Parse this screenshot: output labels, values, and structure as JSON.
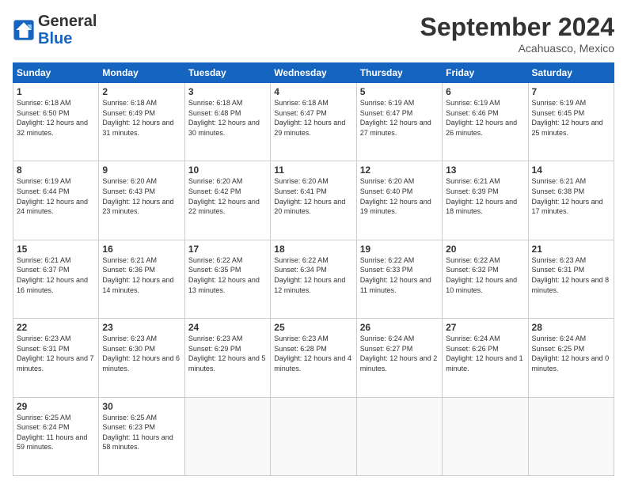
{
  "logo": {
    "text_general": "General",
    "text_blue": "Blue"
  },
  "header": {
    "month_title": "September 2024",
    "subtitle": "Acahuasco, Mexico"
  },
  "weekdays": [
    "Sunday",
    "Monday",
    "Tuesday",
    "Wednesday",
    "Thursday",
    "Friday",
    "Saturday"
  ],
  "weeks": [
    [
      {
        "day": "1",
        "sunrise": "6:18 AM",
        "sunset": "6:50 PM",
        "daylight": "12 hours and 32 minutes."
      },
      {
        "day": "2",
        "sunrise": "6:18 AM",
        "sunset": "6:49 PM",
        "daylight": "12 hours and 31 minutes."
      },
      {
        "day": "3",
        "sunrise": "6:18 AM",
        "sunset": "6:48 PM",
        "daylight": "12 hours and 30 minutes."
      },
      {
        "day": "4",
        "sunrise": "6:18 AM",
        "sunset": "6:47 PM",
        "daylight": "12 hours and 29 minutes."
      },
      {
        "day": "5",
        "sunrise": "6:19 AM",
        "sunset": "6:47 PM",
        "daylight": "12 hours and 27 minutes."
      },
      {
        "day": "6",
        "sunrise": "6:19 AM",
        "sunset": "6:46 PM",
        "daylight": "12 hours and 26 minutes."
      },
      {
        "day": "7",
        "sunrise": "6:19 AM",
        "sunset": "6:45 PM",
        "daylight": "12 hours and 25 minutes."
      }
    ],
    [
      {
        "day": "8",
        "sunrise": "6:19 AM",
        "sunset": "6:44 PM",
        "daylight": "12 hours and 24 minutes."
      },
      {
        "day": "9",
        "sunrise": "6:20 AM",
        "sunset": "6:43 PM",
        "daylight": "12 hours and 23 minutes."
      },
      {
        "day": "10",
        "sunrise": "6:20 AM",
        "sunset": "6:42 PM",
        "daylight": "12 hours and 22 minutes."
      },
      {
        "day": "11",
        "sunrise": "6:20 AM",
        "sunset": "6:41 PM",
        "daylight": "12 hours and 20 minutes."
      },
      {
        "day": "12",
        "sunrise": "6:20 AM",
        "sunset": "6:40 PM",
        "daylight": "12 hours and 19 minutes."
      },
      {
        "day": "13",
        "sunrise": "6:21 AM",
        "sunset": "6:39 PM",
        "daylight": "12 hours and 18 minutes."
      },
      {
        "day": "14",
        "sunrise": "6:21 AM",
        "sunset": "6:38 PM",
        "daylight": "12 hours and 17 minutes."
      }
    ],
    [
      {
        "day": "15",
        "sunrise": "6:21 AM",
        "sunset": "6:37 PM",
        "daylight": "12 hours and 16 minutes."
      },
      {
        "day": "16",
        "sunrise": "6:21 AM",
        "sunset": "6:36 PM",
        "daylight": "12 hours and 14 minutes."
      },
      {
        "day": "17",
        "sunrise": "6:22 AM",
        "sunset": "6:35 PM",
        "daylight": "12 hours and 13 minutes."
      },
      {
        "day": "18",
        "sunrise": "6:22 AM",
        "sunset": "6:34 PM",
        "daylight": "12 hours and 12 minutes."
      },
      {
        "day": "19",
        "sunrise": "6:22 AM",
        "sunset": "6:33 PM",
        "daylight": "12 hours and 11 minutes."
      },
      {
        "day": "20",
        "sunrise": "6:22 AM",
        "sunset": "6:32 PM",
        "daylight": "12 hours and 10 minutes."
      },
      {
        "day": "21",
        "sunrise": "6:23 AM",
        "sunset": "6:31 PM",
        "daylight": "12 hours and 8 minutes."
      }
    ],
    [
      {
        "day": "22",
        "sunrise": "6:23 AM",
        "sunset": "6:31 PM",
        "daylight": "12 hours and 7 minutes."
      },
      {
        "day": "23",
        "sunrise": "6:23 AM",
        "sunset": "6:30 PM",
        "daylight": "12 hours and 6 minutes."
      },
      {
        "day": "24",
        "sunrise": "6:23 AM",
        "sunset": "6:29 PM",
        "daylight": "12 hours and 5 minutes."
      },
      {
        "day": "25",
        "sunrise": "6:23 AM",
        "sunset": "6:28 PM",
        "daylight": "12 hours and 4 minutes."
      },
      {
        "day": "26",
        "sunrise": "6:24 AM",
        "sunset": "6:27 PM",
        "daylight": "12 hours and 2 minutes."
      },
      {
        "day": "27",
        "sunrise": "6:24 AM",
        "sunset": "6:26 PM",
        "daylight": "12 hours and 1 minute."
      },
      {
        "day": "28",
        "sunrise": "6:24 AM",
        "sunset": "6:25 PM",
        "daylight": "12 hours and 0 minutes."
      }
    ],
    [
      {
        "day": "29",
        "sunrise": "6:25 AM",
        "sunset": "6:24 PM",
        "daylight": "11 hours and 59 minutes."
      },
      {
        "day": "30",
        "sunrise": "6:25 AM",
        "sunset": "6:23 PM",
        "daylight": "11 hours and 58 minutes."
      },
      null,
      null,
      null,
      null,
      null
    ]
  ]
}
